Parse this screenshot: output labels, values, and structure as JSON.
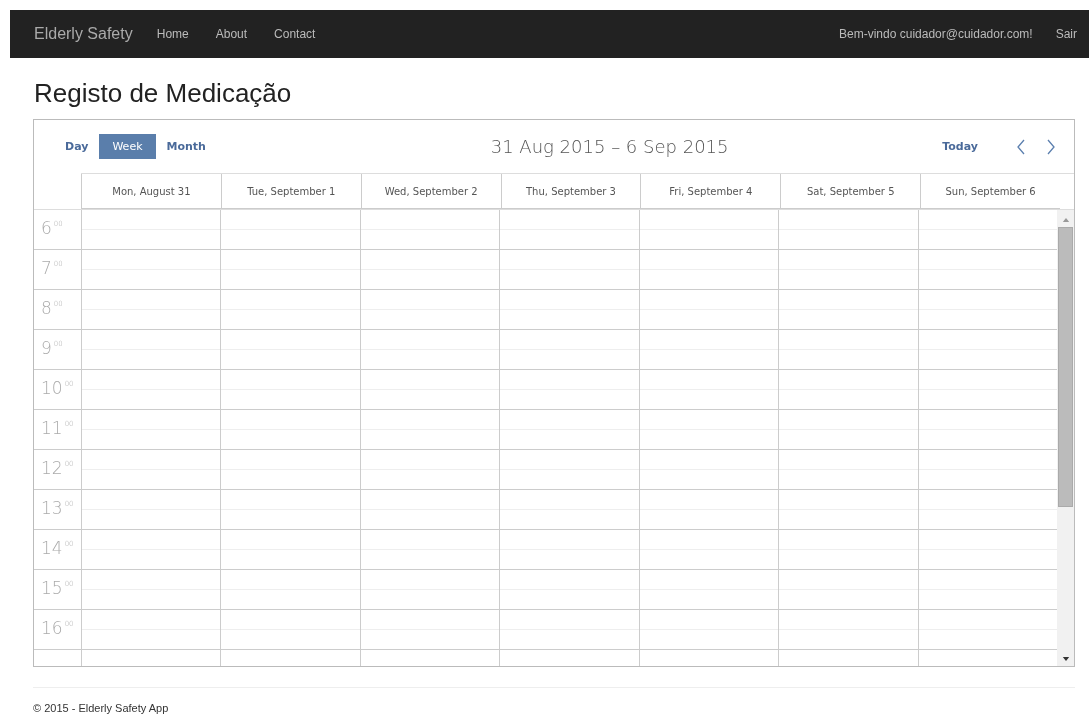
{
  "navbar": {
    "brand": "Elderly Safety",
    "links": [
      "Home",
      "About",
      "Contact"
    ],
    "welcome": "Bem-vindo cuidador@cuidador.com!",
    "logout": "Sair"
  },
  "page_title": "Registo de Medicação",
  "calendar": {
    "views": [
      {
        "label": "Day",
        "selected": false
      },
      {
        "label": "Week",
        "selected": true
      },
      {
        "label": "Month",
        "selected": false
      }
    ],
    "range_title": "31 Aug 2015 – 6 Sep 2015",
    "today_button": "Today",
    "days": [
      "Mon, August 31",
      "Tue, September 1",
      "Wed, September 2",
      "Thu, September 3",
      "Fri, September 4",
      "Sat, September 5",
      "Sun, September 6"
    ],
    "hours": [
      "6$^{00}$",
      "7$^{00}$",
      "8$^{00}$",
      "9$^{00}$",
      "10$^{00}$",
      "11$^{00}$",
      "12$^{00}$",
      "13$^{00}$",
      "14$^{00}$",
      "15$^{00}$",
      "16$^{00}$"
    ]
  },
  "footer": "© 2015 - Elderly Safety App"
}
